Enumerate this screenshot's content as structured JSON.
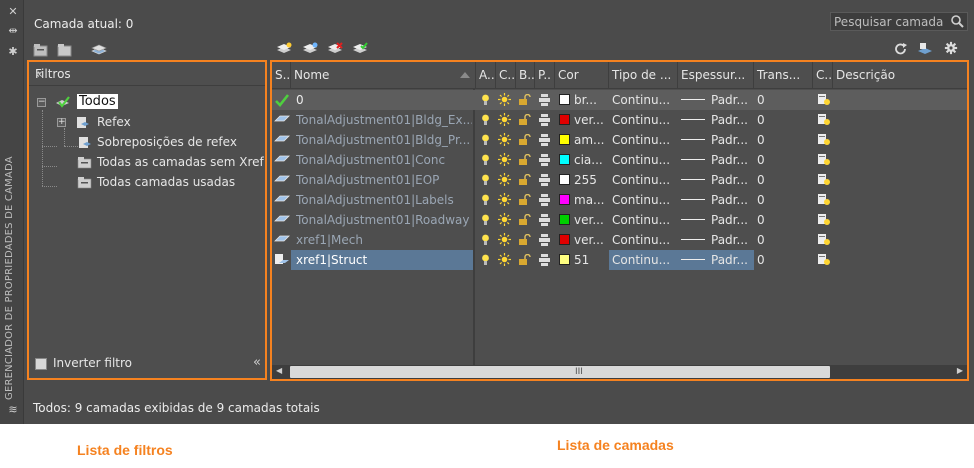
{
  "palette": {
    "window_bg": "#4b4b4b",
    "panel_bg": "#4e4e4e",
    "accent_orange": "#f58220",
    "selected_row": "#5b7896"
  },
  "sidebar_strip": {
    "title": "GERENCIADOR DE PROPRIEDADES DE CAMADA",
    "icons": [
      "close-icon",
      "autohide-icon",
      "properties-icon",
      "layer-states-icon"
    ]
  },
  "header": {
    "current_layer": "Camada atual: 0",
    "search_placeholder": "Pesquisar camada"
  },
  "toolbar_left": [
    "new-property-filter-icon",
    "new-group-filter-icon",
    "layer-states-manager-icon"
  ],
  "toolbar_layers": [
    "new-layer-icon",
    "new-layer-vp-frozen-icon",
    "delete-layer-icon",
    "set-current-icon"
  ],
  "toolbar_right": [
    "refresh-icon",
    "settings-layers-icon",
    "gear-icon"
  ],
  "filters_panel": {
    "title": "Filtros",
    "tree": [
      {
        "label": "Todos",
        "level": 0,
        "expanded": true,
        "selected": true
      },
      {
        "label": "Refex",
        "level": 1,
        "expandable": true
      },
      {
        "label": "Sobreposições de refex",
        "level": 2
      },
      {
        "label": "Todas as camadas sem Xref",
        "level": 1
      },
      {
        "label": "Todas camadas usadas",
        "level": 1
      }
    ],
    "invert_filter_label": "Inverter filtro",
    "invert_filter_checked": false
  },
  "layers_panel": {
    "columns": [
      "S..",
      "Nome",
      "A..",
      "C..",
      "B..",
      "P..",
      "Cor",
      "Tipo de ...",
      "Espessur...",
      "Trans...",
      "C..",
      "Descrição"
    ],
    "rows": [
      {
        "status": "current",
        "name": "0",
        "color_name": "br...",
        "color_hex": "#ffffff",
        "linetype": "Continu...",
        "lineweight": "Padr...",
        "transparency": "0"
      },
      {
        "status": "xref",
        "name": "TonalAdjustment01|Bldg_Ex...",
        "color_name": "ver...",
        "color_hex": "#e00000",
        "linetype": "Continu...",
        "lineweight": "Padr...",
        "transparency": "0"
      },
      {
        "status": "xref",
        "name": "TonalAdjustment01|Bldg_Pr...",
        "color_name": "am...",
        "color_hex": "#ffff00",
        "linetype": "Continu...",
        "lineweight": "Padr...",
        "transparency": "0"
      },
      {
        "status": "xref",
        "name": "TonalAdjustment01|Conc",
        "color_name": "cia...",
        "color_hex": "#00ffff",
        "linetype": "Continu...",
        "lineweight": "Padr...",
        "transparency": "0"
      },
      {
        "status": "xref",
        "name": "TonalAdjustment01|EOP",
        "color_name": "255",
        "color_hex": "#ffffff",
        "linetype": "Continu...",
        "lineweight": "Padr...",
        "transparency": "0"
      },
      {
        "status": "xref",
        "name": "TonalAdjustment01|Labels",
        "color_name": "ma...",
        "color_hex": "#ff00ff",
        "linetype": "Continu...",
        "lineweight": "Padr...",
        "transparency": "0"
      },
      {
        "status": "xref",
        "name": "TonalAdjustment01|Roadway",
        "color_name": "ver...",
        "color_hex": "#00d000",
        "linetype": "Continu...",
        "lineweight": "Padr...",
        "transparency": "0"
      },
      {
        "status": "xref",
        "name": "xref1|Mech",
        "color_name": "ver...",
        "color_hex": "#e00000",
        "linetype": "Continu...",
        "lineweight": "Padr...",
        "transparency": "0"
      },
      {
        "status": "xref-selected",
        "name": "xref1|Struct",
        "color_name": "51",
        "color_hex": "#ffff80",
        "linetype": "Continu...",
        "lineweight": "Padr...",
        "transparency": "0"
      }
    ]
  },
  "status_bar": "Todos: 9 camadas exibidas de 9 camadas totais",
  "captions": {
    "filters": "Lista de filtros",
    "layers": "Lista de camadas"
  }
}
